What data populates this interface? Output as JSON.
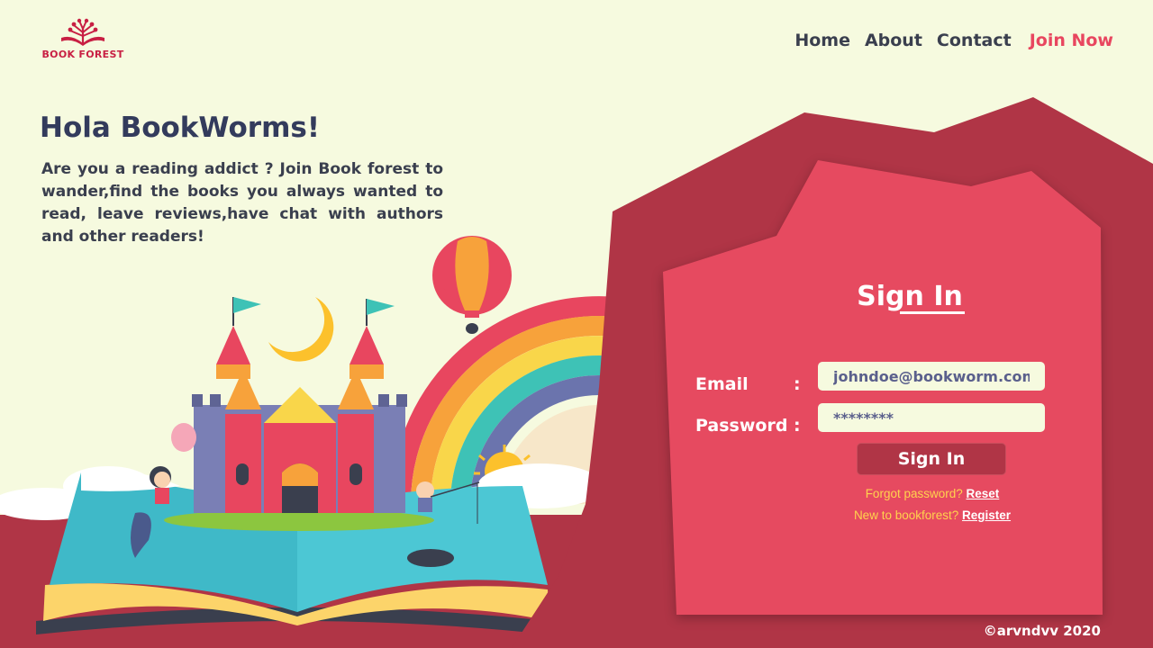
{
  "logo": {
    "text": "BOOK FOREST",
    "icon": "book-tree-icon",
    "color": "#c81f43"
  },
  "nav": {
    "home": "Home",
    "about": "About",
    "contact": "Contact",
    "join": "Join Now"
  },
  "hero": {
    "title": "Hola BookWorms!",
    "text": "Are you a reading addict ? Join Book forest to wander,find the books you always wanted to read, leave reviews,have chat with authors and other readers!"
  },
  "signin": {
    "title": "Sign In",
    "email_label": "Email",
    "password_label": "Password",
    "colon": ":",
    "email_value": "johndoe@bookworm.com",
    "password_value": "********",
    "button_label": "Sign In",
    "forgot_text": "Forgot password?",
    "reset_link": "Reset",
    "new_text": "New to bookforest?",
    "register_link": "Register"
  },
  "footer": {
    "copyright": "©arvndvv 2020"
  },
  "colors": {
    "background": "#f6fadf",
    "accent": "#e8465f",
    "panel_dark": "#b03546",
    "panel": "#e64a60",
    "help_text": "#ffd34d",
    "title_text": "#333b5c"
  }
}
